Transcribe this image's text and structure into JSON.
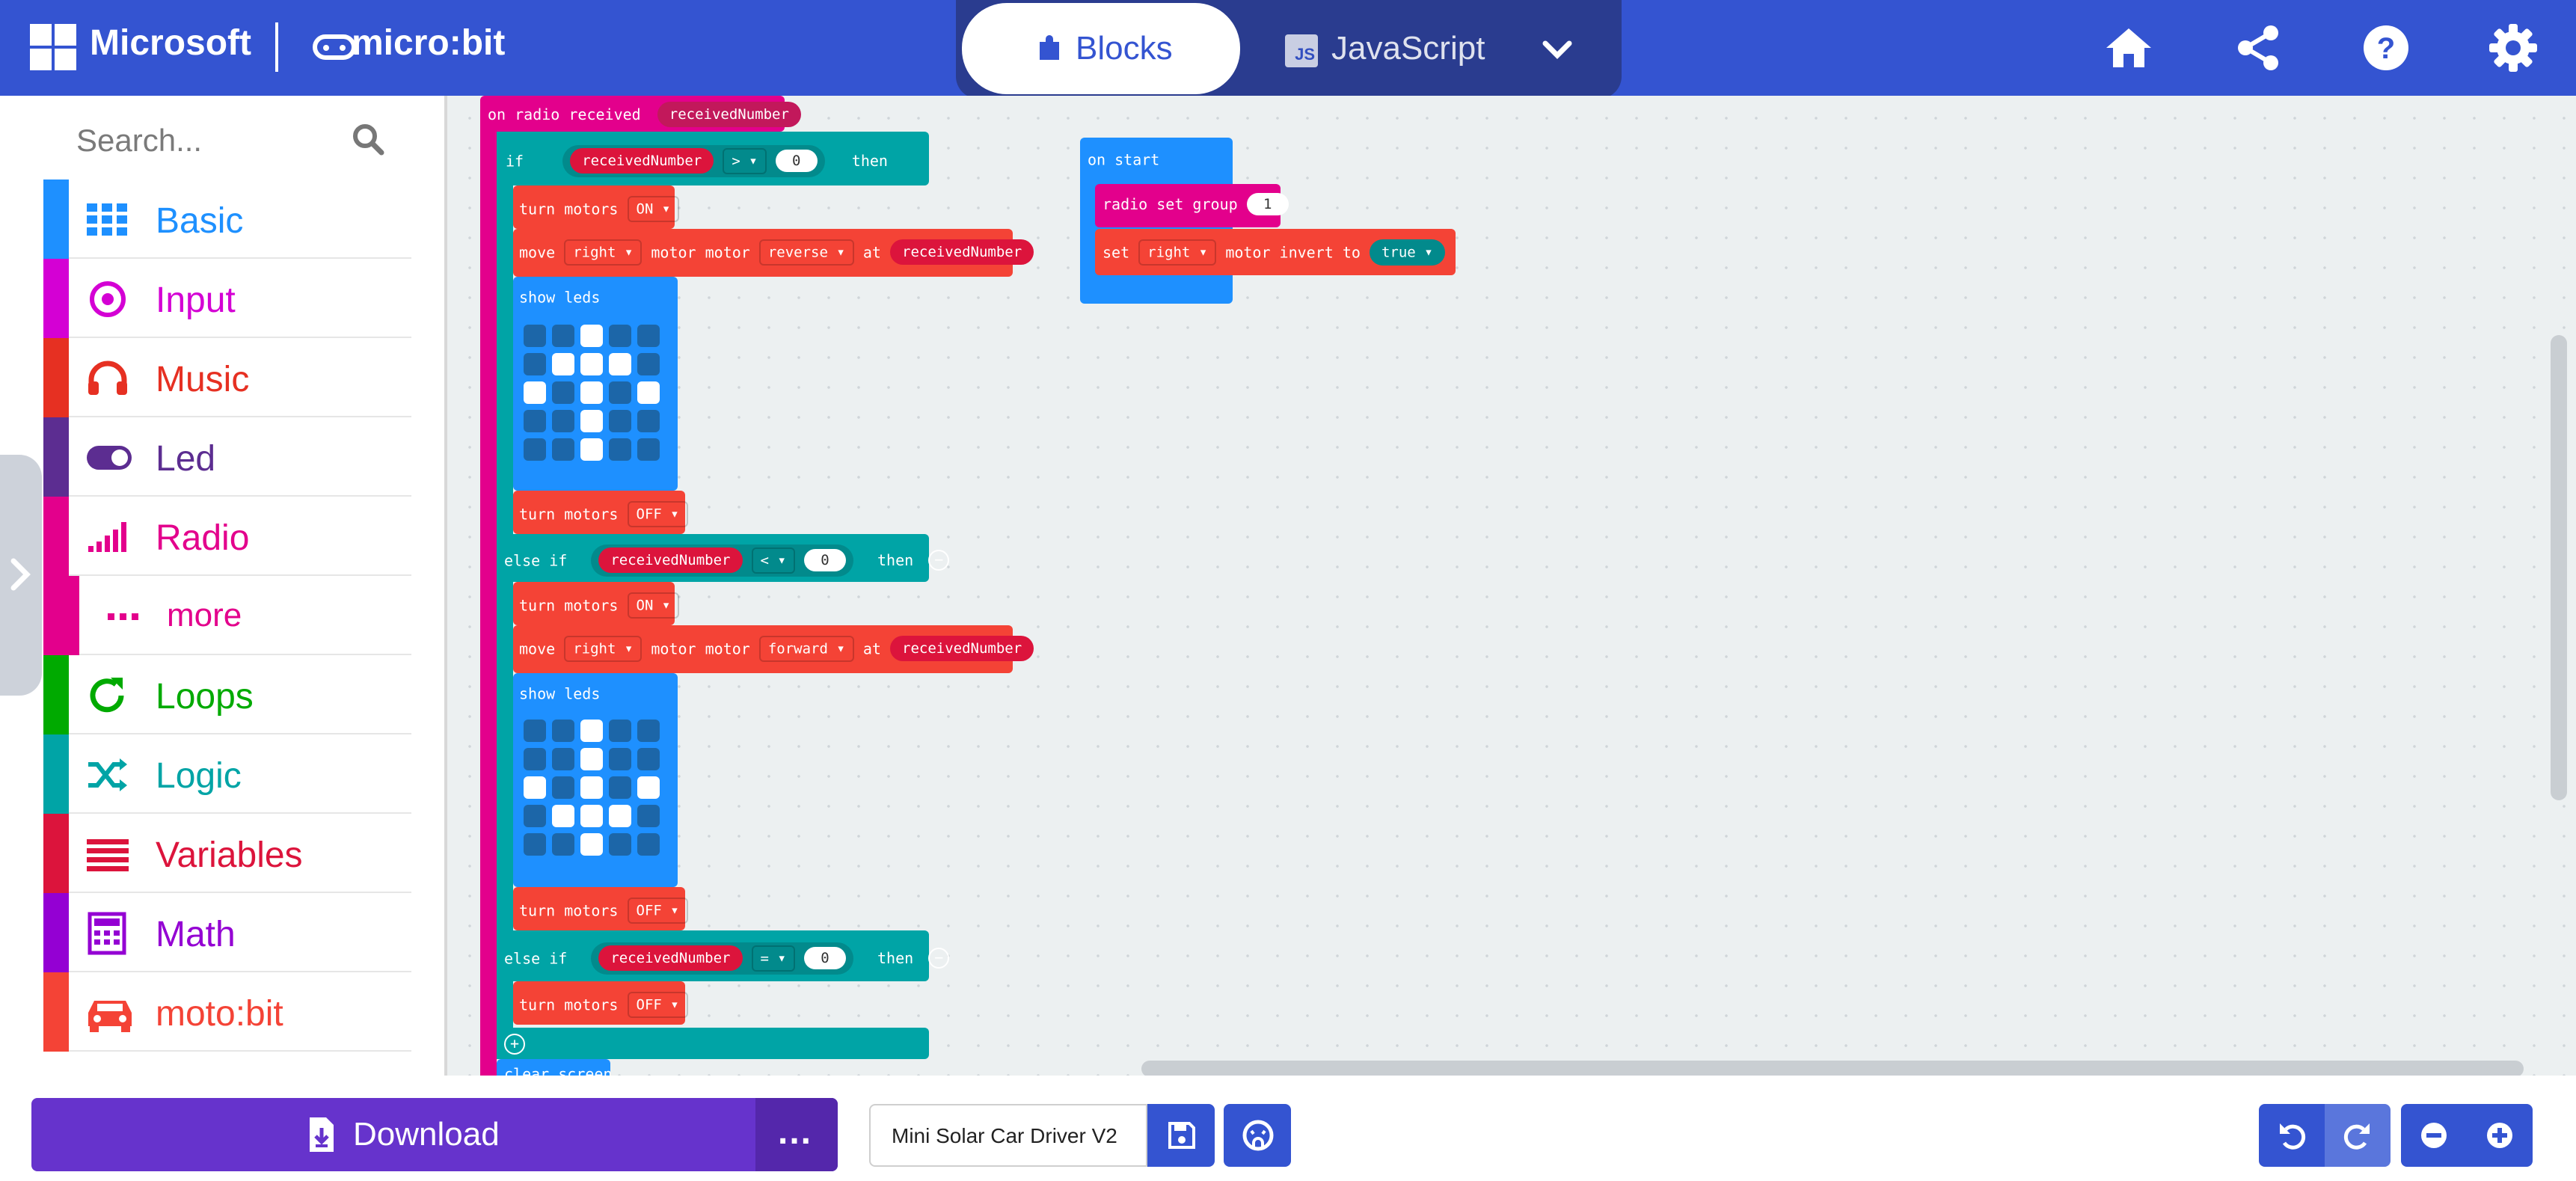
{
  "header": {
    "brand": "Microsoft",
    "product": "micro:bit",
    "tabs": [
      {
        "label": "Blocks",
        "active": true,
        "icon": "puzzle-icon"
      },
      {
        "label": "JavaScript",
        "active": false,
        "icon": "js-icon",
        "icon_text": "JS"
      }
    ],
    "actions": [
      "home-icon",
      "share-icon",
      "help-icon",
      "settings-icon"
    ]
  },
  "toolbox": {
    "search_placeholder": "Search...",
    "categories": [
      {
        "label": "Basic",
        "color": "#1e90ff",
        "icon": "grid-icon"
      },
      {
        "label": "Input",
        "color": "#d400d4",
        "icon": "target-icon"
      },
      {
        "label": "Music",
        "color": "#e63022",
        "icon": "headphones-icon"
      },
      {
        "label": "Led",
        "color": "#5c2d91",
        "icon": "toggle-icon"
      },
      {
        "label": "Radio",
        "color": "#e3008c",
        "icon": "signal-icon"
      },
      {
        "label": "more",
        "color": "#e3008c",
        "icon": "ellipsis-icon"
      },
      {
        "label": "Loops",
        "color": "#00aa00",
        "icon": "loop-icon"
      },
      {
        "label": "Logic",
        "color": "#00a4a6",
        "icon": "shuffle-icon"
      },
      {
        "label": "Variables",
        "color": "#dc143c",
        "icon": "list-icon"
      },
      {
        "label": "Math",
        "color": "#9400d3",
        "icon": "calculator-icon"
      },
      {
        "label": "moto:bit",
        "color": "#f44336",
        "icon": "car-icon"
      }
    ]
  },
  "blocks": {
    "radio_event": {
      "label": "on radio received",
      "param": "receivedNumber"
    },
    "if1": {
      "kw_if": "if",
      "var": "receivedNumber",
      "op": ">",
      "val": "0",
      "kw_then": "then"
    },
    "turn_on_1": {
      "label": "turn motors",
      "state": "ON"
    },
    "move1": {
      "label": "move",
      "side": "right",
      "mid": "motor motor",
      "dir": "reverse",
      "at": "at",
      "var": "receivedNumber"
    },
    "leds1": {
      "label": "show leds",
      "grid": [
        [
          0,
          0,
          1,
          0,
          0
        ],
        [
          0,
          1,
          1,
          1,
          0
        ],
        [
          1,
          0,
          1,
          0,
          1
        ],
        [
          0,
          0,
          1,
          0,
          0
        ],
        [
          0,
          0,
          1,
          0,
          0
        ]
      ]
    },
    "turn_off_1": {
      "label": "turn motors",
      "state": "OFF"
    },
    "elseif1": {
      "kw": "else if",
      "var": "receivedNumber",
      "op": "<",
      "val": "0",
      "kw_then": "then"
    },
    "turn_on_2": {
      "label": "turn motors",
      "state": "ON"
    },
    "move2": {
      "label": "move",
      "side": "right",
      "mid": "motor motor",
      "dir": "forward",
      "at": "at",
      "var": "receivedNumber"
    },
    "leds2": {
      "label": "show leds",
      "grid": [
        [
          0,
          0,
          1,
          0,
          0
        ],
        [
          0,
          0,
          1,
          0,
          0
        ],
        [
          1,
          0,
          1,
          0,
          1
        ],
        [
          0,
          1,
          1,
          1,
          0
        ],
        [
          0,
          0,
          1,
          0,
          0
        ]
      ]
    },
    "turn_off_2": {
      "label": "turn motors",
      "state": "OFF"
    },
    "elseif2": {
      "kw": "else if",
      "var": "receivedNumber",
      "op": "=",
      "val": "0",
      "kw_then": "then"
    },
    "turn_off_3": {
      "label": "turn motors",
      "state": "OFF"
    },
    "clear": {
      "label": "clear screen"
    },
    "on_start": {
      "label": "on start"
    },
    "radio_group": {
      "label": "radio set group",
      "val": "1"
    },
    "invert": {
      "label": "set",
      "side": "right",
      "mid": "motor invert to",
      "val": "true"
    }
  },
  "footer": {
    "download_label": "Download",
    "more_label": "...",
    "project_name": "Mini Solar Car Driver V2"
  },
  "colors": {
    "header": "#3454d1",
    "download": "#6633cc",
    "logic_block": "#00a4a6",
    "motobit_block": "#f44336",
    "radio_block": "#e3008c",
    "basic_block": "#1e90ff"
  }
}
